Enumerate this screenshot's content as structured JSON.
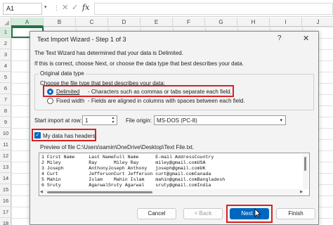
{
  "excel": {
    "name_box": "A1",
    "fx_label": "fx",
    "columns": [
      "A",
      "B",
      "C",
      "D",
      "E",
      "F",
      "G",
      "H",
      "I",
      "J"
    ],
    "rows": [
      "1",
      "2",
      "3",
      "4",
      "5",
      "6",
      "7",
      "8",
      "9",
      "10",
      "11",
      "12",
      "13",
      "14",
      "15",
      "16",
      "17",
      "18"
    ]
  },
  "dialog": {
    "title": "Text Import Wizard - Step 1 of 3",
    "help_icon": "?",
    "close_icon": "✕",
    "intro_line1": "The Text Wizard has determined that your data is Delimited.",
    "intro_line2": "If this is correct, choose Next, or choose the data type that best describes your data.",
    "group_label": "Original data type",
    "choose_label": "Choose the file type that best describes your data:",
    "options": [
      {
        "label": "Delimited",
        "desc": "- Characters such as commas or tabs separate each field.",
        "selected": true
      },
      {
        "label": "Fixed width",
        "desc": "- Fields are aligned in columns with spaces between each field.",
        "selected": false
      }
    ],
    "start_row_label": "Start import at row:",
    "start_row_value": "1",
    "origin_label": "File origin:",
    "origin_value": "MS-DOS (PC-8)",
    "headers_label": "My data has headers.",
    "headers_checked": true,
    "preview_label": "Preview of file C:\\Users\\samin\\OneDrive\\Desktop\\Text File.txt.",
    "preview_lines": [
      "1 First Name     Last NameFull Name      E-mail AddressCountry",
      "2 Miley          Ray      Miley Ray      miley@gmail.comUSA",
      "3 Joseph         AnthonyJoseph Anthony   joseph@gmail.comUK",
      "4 Curt           JeffersonCurt Jefferson curt@gmail.comCanada",
      "5 Mahin          Islam    Mahin Islam    mahin@gmail.comBangladesh",
      "6 Sruty          AgarwalSruty Agarwal    sruty@gmail.comIndia"
    ],
    "buttons": {
      "cancel": "Cancel",
      "back": "< Back",
      "next": "Next >",
      "finish": "Finish"
    },
    "highlight_color": "#d92020",
    "accent_color": "#0067c0"
  }
}
